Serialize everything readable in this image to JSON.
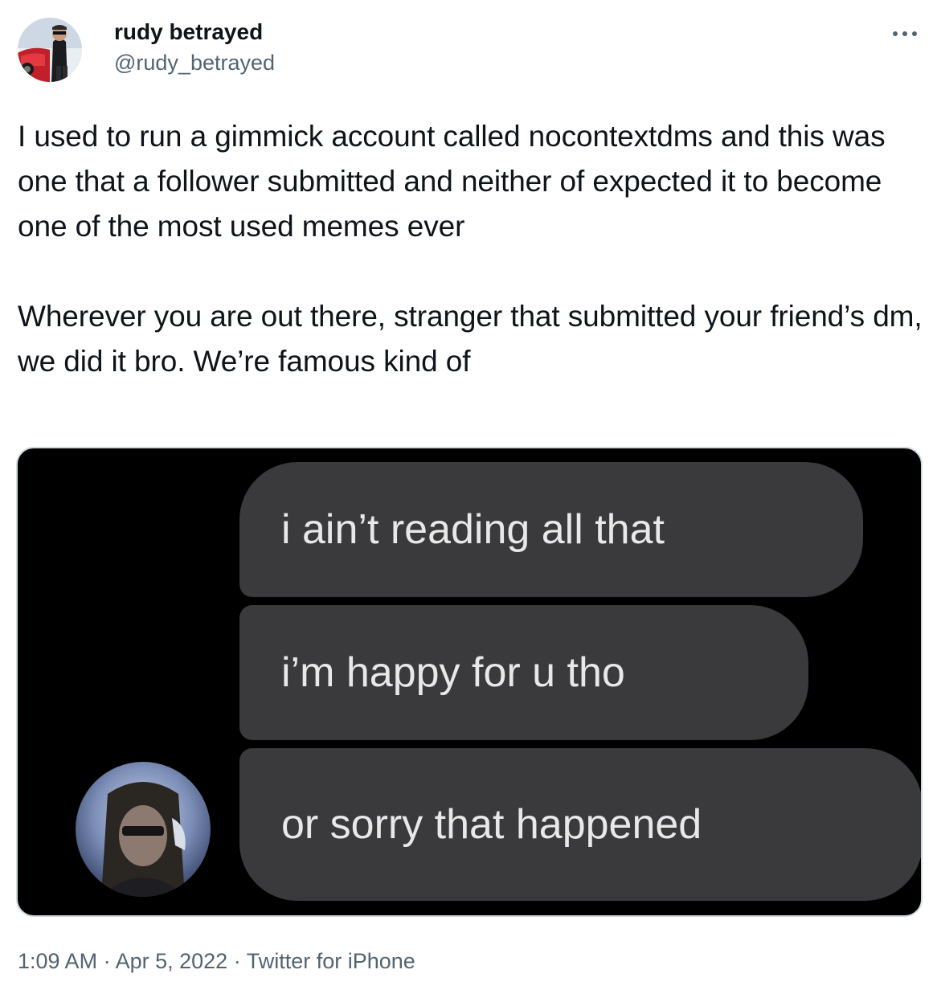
{
  "tweet": {
    "author": {
      "display_name": "rudy betrayed",
      "handle": "@rudy_betrayed",
      "avatar_icon": "profile-photo"
    },
    "more_icon": "ellipsis-icon",
    "text": "I used to run a gimmick account called nocontextdms and this was one that a follower submitted and neither of expected it to become one of the most used memes ever\n\nWherever you are out there, stranger that submitted your friend’s dm, we did it bro. We’re famous kind of",
    "media": {
      "messages": [
        "i ain’t reading all that",
        "i’m happy for u tho",
        "or sorry that happened"
      ],
      "sender_avatar_icon": "dm-avatar-photo",
      "bubble_color": "#3a3a3c",
      "background_color": "#000000"
    },
    "meta": {
      "time": "1:09 AM",
      "separator": " · ",
      "date": "Apr 5, 2022",
      "source": "Twitter for iPhone"
    }
  }
}
